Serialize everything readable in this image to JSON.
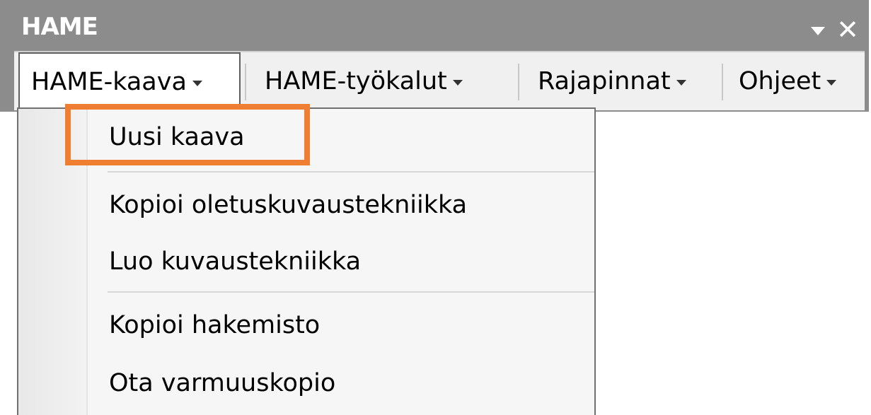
{
  "window": {
    "title": "HAME",
    "controls": {
      "dropdown_icon": "chevron-down-icon",
      "close_label": "✕"
    }
  },
  "menu": {
    "items": [
      {
        "label": "HAME-kaava"
      },
      {
        "label": "HAME-työkalut"
      },
      {
        "label": "Rajapinnat"
      },
      {
        "label": "Ohjeet"
      }
    ]
  },
  "dropdown": {
    "items": [
      {
        "label": "Uusi kaava",
        "highlighted": true
      },
      {
        "label": "Kopioi oletuskuvaustekniikka"
      },
      {
        "label": "Luo kuvaustekniikka"
      },
      {
        "label": "Kopioi hakemisto"
      },
      {
        "label": "Ota varmuuskopio"
      }
    ]
  },
  "colors": {
    "highlight": "#ef7e33",
    "titlebar": "#8c8c8c"
  }
}
